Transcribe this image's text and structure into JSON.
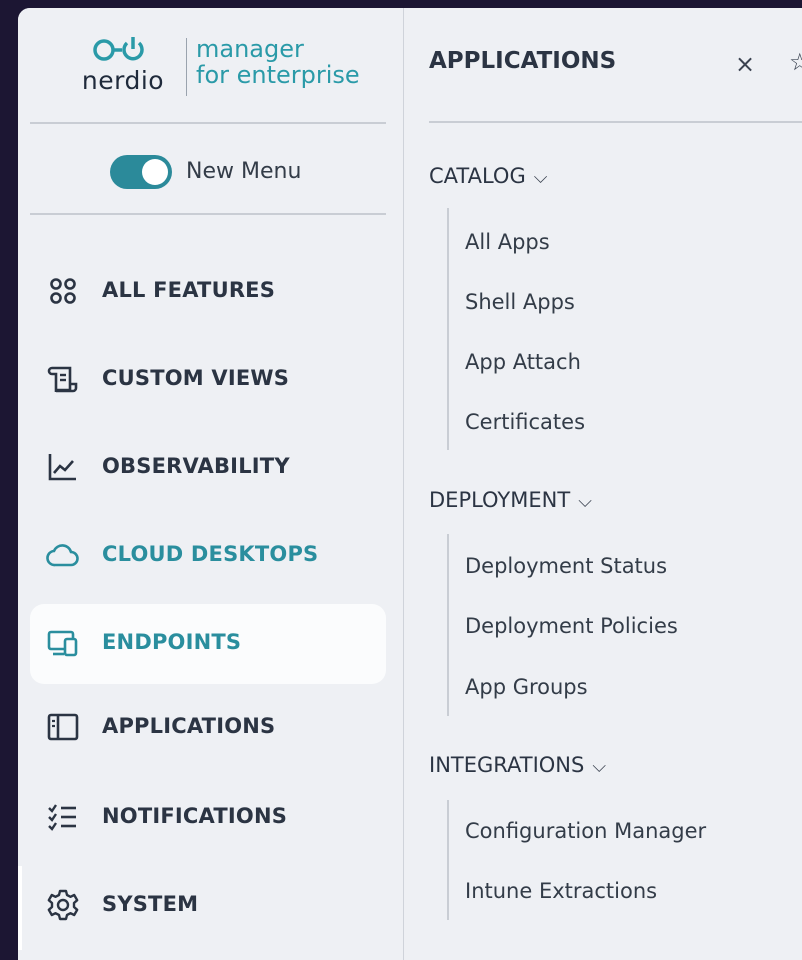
{
  "brand": {
    "wordmark": "nerdio",
    "product_line1": "manager",
    "product_line2": "for enterprise",
    "accent_color": "#2a9aa8"
  },
  "toggle": {
    "label": "New Menu",
    "state": "on"
  },
  "nav": {
    "items": [
      {
        "label": "ALL FEATURES",
        "icon": "grid-circles-icon"
      },
      {
        "label": "CUSTOM VIEWS",
        "icon": "scroll-icon"
      },
      {
        "label": "OBSERVABILITY",
        "icon": "line-chart-icon"
      },
      {
        "label": "CLOUD DESKTOPS",
        "icon": "cloud-icon"
      },
      {
        "label": "ENDPOINTS",
        "icon": "devices-icon",
        "active": true
      },
      {
        "label": "APPLICATIONS",
        "icon": "app-window-icon"
      },
      {
        "label": "NOTIFICATIONS",
        "icon": "checklist-icon"
      },
      {
        "label": "SYSTEM",
        "icon": "gear-icon"
      }
    ]
  },
  "panel": {
    "title": "APPLICATIONS",
    "close_glyph": "×",
    "pin_glyph": "☆",
    "sections": [
      {
        "label": "CATALOG",
        "items": [
          "All Apps",
          "Shell Apps",
          "App Attach",
          "Certificates"
        ]
      },
      {
        "label": "DEPLOYMENT",
        "items": [
          "Deployment Status",
          "Deployment Policies",
          "App Groups"
        ]
      },
      {
        "label": "INTEGRATIONS",
        "items": [
          "Configuration Manager",
          "Intune Extractions"
        ]
      }
    ]
  }
}
